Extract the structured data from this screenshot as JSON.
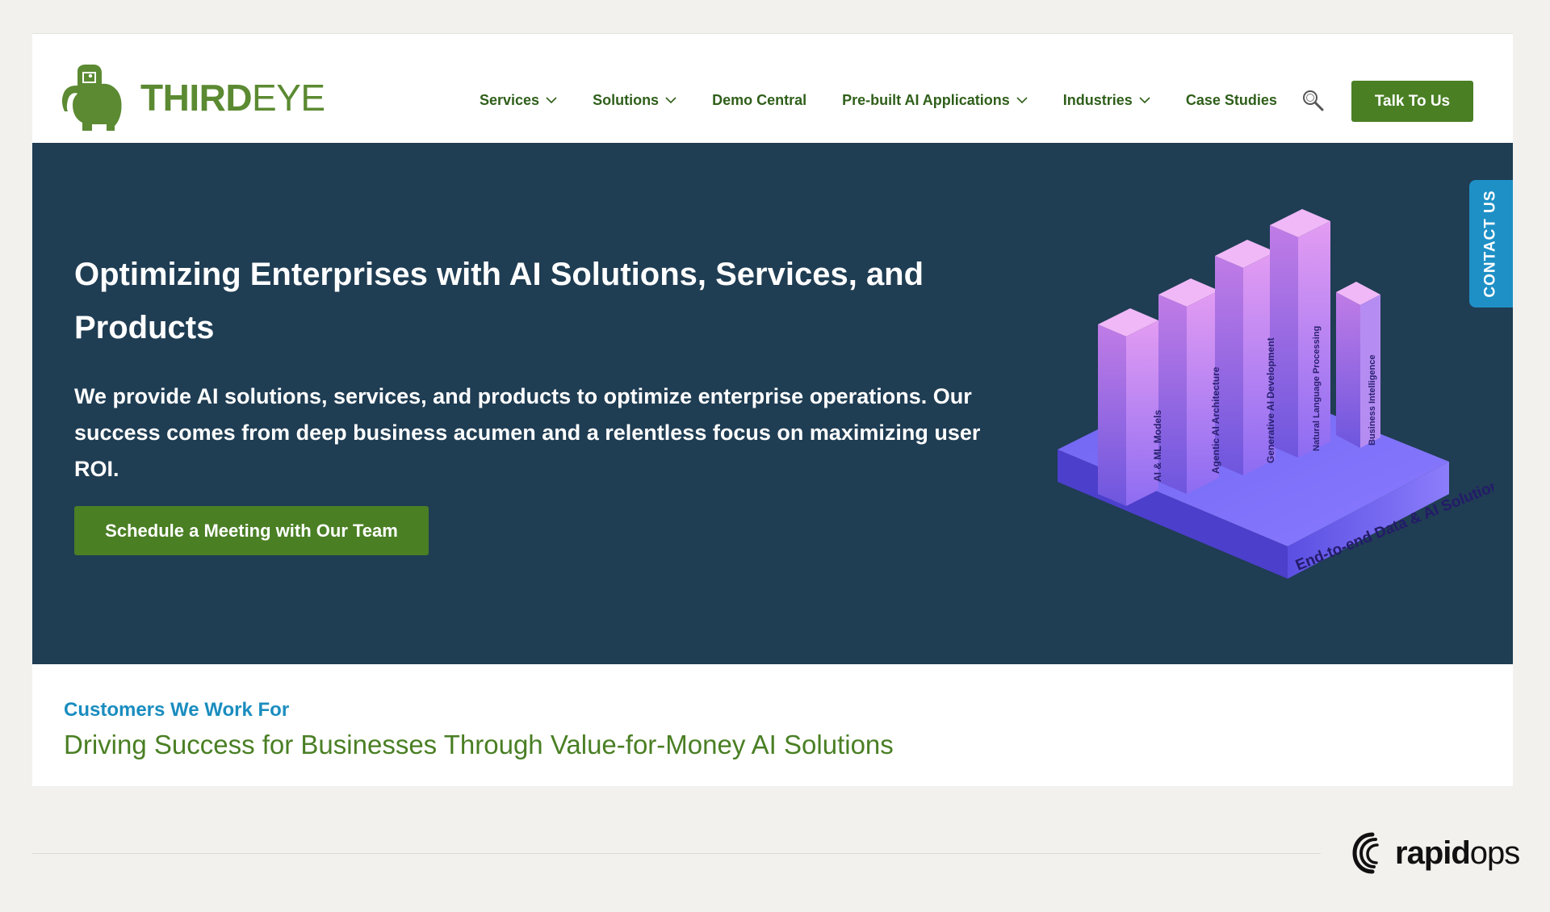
{
  "brand": {
    "name_bold": "THIRD",
    "name_light": "EYE",
    "color": "#5b8a32"
  },
  "nav": {
    "items": [
      {
        "label": "Services",
        "has_dropdown": true
      },
      {
        "label": "Solutions",
        "has_dropdown": true
      },
      {
        "label": "Demo Central",
        "has_dropdown": false
      },
      {
        "label": "Pre-built AI Applications",
        "has_dropdown": true
      },
      {
        "label": "Industries",
        "has_dropdown": true
      },
      {
        "label": "Case Studies",
        "has_dropdown": false
      }
    ],
    "search_icon": "search-icon",
    "cta_label": "Talk To Us"
  },
  "hero": {
    "title": "Optimizing Enterprises with AI Solutions, Services, and Products",
    "description": "We provide AI solutions, services, and products to optimize enterprise operations. Our success comes from deep business acumen and a relentless focus on maximizing user ROI.",
    "cta_label": "Schedule a Meeting with Our Team",
    "background": "#1f3d53",
    "visual": {
      "base_label": "End-to-end Data & AI Solutions",
      "columns": [
        "AI & ML Models",
        "Agentic AI Architecture",
        "Generative AI Development",
        "Natural Language Processing",
        "Business Intelligence"
      ]
    }
  },
  "contact_tab": {
    "label": "CONTACT US",
    "color": "#1e90c6"
  },
  "customers": {
    "eyebrow": "Customers We Work For",
    "heading": "Driving Success for Businesses Through Value-for-Money AI Solutions"
  },
  "footer": {
    "brand_bold": "rapid",
    "brand_light": "ops"
  },
  "colors": {
    "accent_green": "#4a7f24",
    "accent_blue": "#1a8dbf",
    "page_bg": "#f2f1ee"
  }
}
